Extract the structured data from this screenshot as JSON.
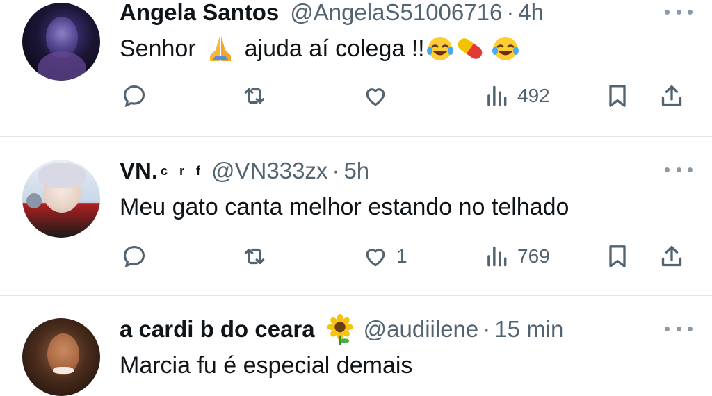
{
  "tweets": [
    {
      "name": "Angela Santos",
      "name_badge": "",
      "handle": "@AngelaS51006716",
      "separator": "·",
      "time": "4h",
      "text_parts": [
        "Senhor",
        "ajuda aí colega !!"
      ],
      "emojis": [
        "folded-hands",
        "tears-of-joy",
        "pill",
        "tears-of-joy"
      ],
      "actions": {
        "replies": "",
        "retweets": "",
        "likes": "",
        "views": "492"
      }
    },
    {
      "name": "VN.",
      "name_badge": "c r f",
      "handle": "@VN333zx",
      "separator": "·",
      "time": "5h",
      "text_parts": [
        "Meu gato canta melhor estando no telhado"
      ],
      "emojis": [],
      "actions": {
        "replies": "",
        "retweets": "",
        "likes": "1",
        "views": "769"
      }
    },
    {
      "name": "a cardi b do ceara",
      "name_badge": "sunflower",
      "handle": "@audiilene",
      "separator": "·",
      "time": "15 min",
      "text_parts": [
        "Marcia fu é especial demais"
      ],
      "emojis": [],
      "actions": {
        "replies": "",
        "retweets": "",
        "likes": "",
        "views": ""
      }
    }
  ],
  "colors": {
    "text": "#0f1419",
    "muted": "#536471",
    "divider": "#e1e6ea"
  }
}
